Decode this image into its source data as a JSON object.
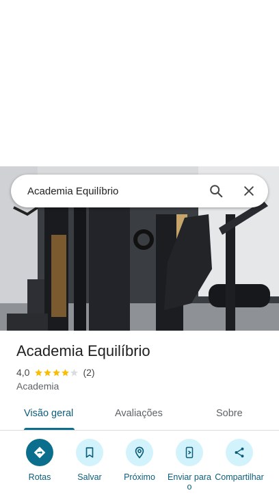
{
  "search": {
    "query": "Academia Equilíbrio",
    "icon": "search-icon",
    "clear_icon": "close-icon"
  },
  "place": {
    "name": "Academia Equilíbrio",
    "rating": "4,0",
    "rating_value": 4,
    "rating_max": 5,
    "review_count": "(2)",
    "category": "Academia"
  },
  "tabs": [
    {
      "label": "Visão geral",
      "active": true
    },
    {
      "label": "Avaliações",
      "active": false
    },
    {
      "label": "Sobre",
      "active": false
    }
  ],
  "actions": [
    {
      "label": "Rotas",
      "icon": "directions-icon"
    },
    {
      "label": "Salvar",
      "icon": "bookmark-icon"
    },
    {
      "label": "Próximo",
      "icon": "nearby-icon"
    },
    {
      "label": "Enviar para o",
      "icon": "send-to-phone-icon"
    },
    {
      "label": "Compartilhar",
      "icon": "share-icon"
    }
  ],
  "colors": {
    "accent": "#0b6e8c",
    "accent_text": "#0b5c7a",
    "chip_bg": "#d2f3fb",
    "star": "#fbbc04",
    "star_empty": "#dadce0"
  }
}
